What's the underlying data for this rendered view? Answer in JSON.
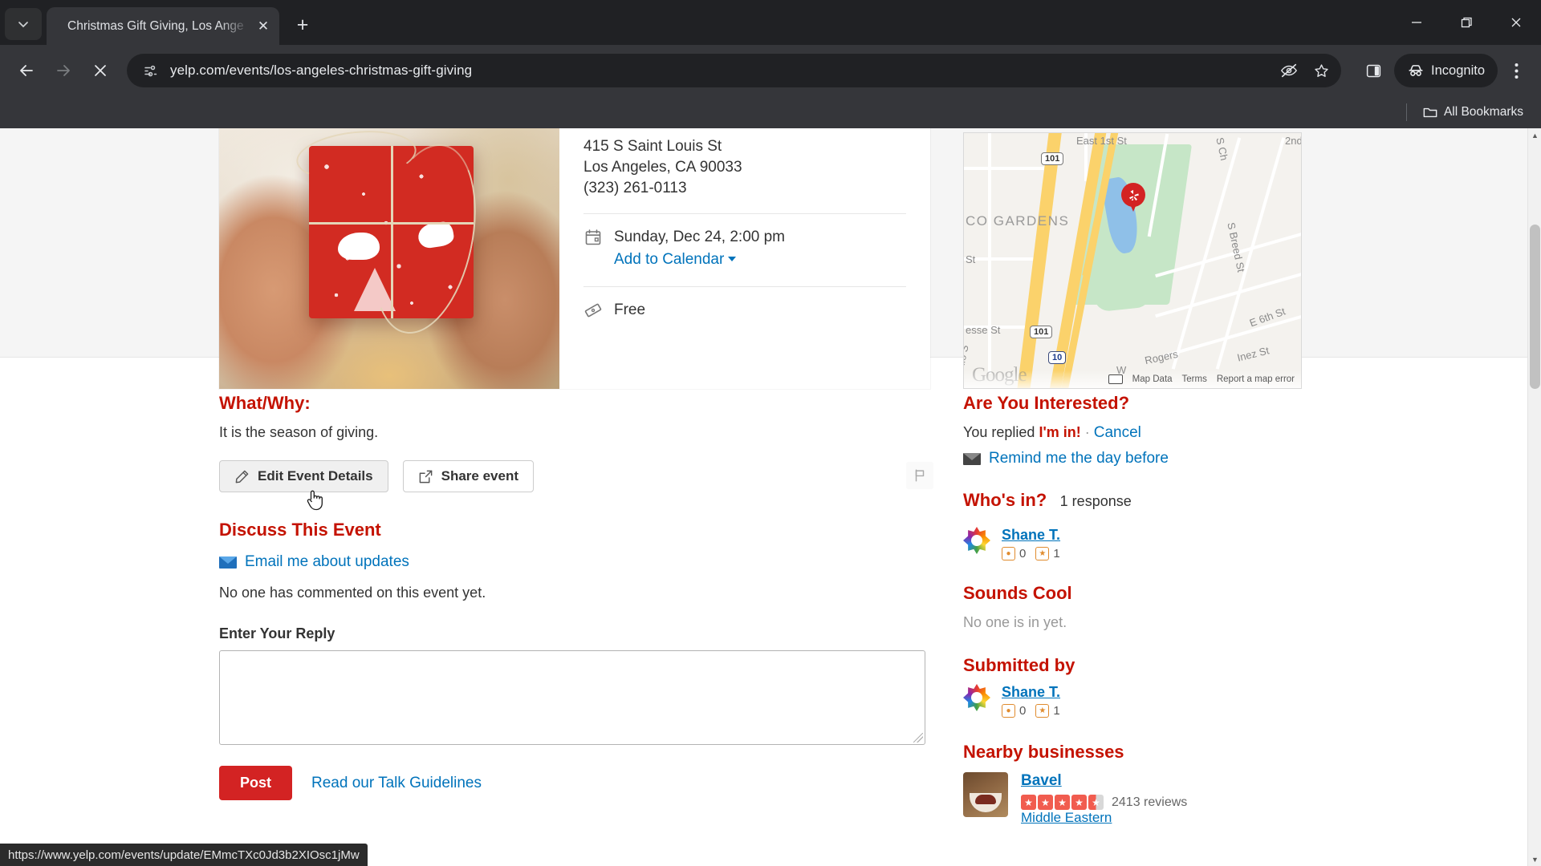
{
  "browser": {
    "tab": {
      "title": "Christmas Gift Giving, Los Ange",
      "close_label": "✕"
    },
    "new_tab_label": "+",
    "tab_search_icon": "chevron-down-icon",
    "window": {
      "minimize": "—",
      "maximize": "❐",
      "close": "✕"
    },
    "nav": {
      "back": "←",
      "forward": "→",
      "stop": "✕"
    },
    "omnibox": {
      "url": "yelp.com/events/los-angeles-christmas-gift-giving",
      "site_info_icon": "page-info-icon",
      "tracking_icon": "eye-slash-icon",
      "bookmark_icon": "star-icon"
    },
    "side_panel_icon": "side-panel-icon",
    "profile": {
      "label": "Incognito",
      "icon": "incognito-icon"
    },
    "menu_icon": "three-dot-menu-icon",
    "bookmarks": {
      "all_label": "All Bookmarks",
      "folder_icon": "folder-icon"
    },
    "status_bar_url": "https://www.yelp.com/events/update/EMmcTXc0Jd3b2XIOsc1jMw"
  },
  "event": {
    "photo_alt": "hands holding red wrapped christmas gift",
    "address": {
      "street": "415 S Saint Louis St",
      "city_state_zip": "Los Angeles, CA 90033",
      "phone": "(323) 261-0113"
    },
    "datetime": {
      "icon": "calendar-icon",
      "text": "Sunday, Dec 24, 2:00 pm",
      "add_to_calendar": "Add to Calendar"
    },
    "price": {
      "icon": "ticket-icon",
      "text": "Free"
    }
  },
  "map": {
    "labels": [
      "East 1st St",
      "CO GARDENS",
      "St",
      "esse St",
      "Rio S",
      "S Breed St",
      "S Ch",
      "2nd",
      "E 6th St",
      "Inez St",
      "Rogers",
      "W"
    ],
    "shields": [
      "101",
      "101",
      "10"
    ],
    "attribution": {
      "map_data": "Map Data",
      "terms": "Terms",
      "report": "Report a map error",
      "watermark": "Google",
      "keyboard_icon": "keyboard-shortcuts-icon"
    },
    "pin_icon": "yelp-pin-icon"
  },
  "left": {
    "whatwhy_heading": "What/Why:",
    "whatwhy_body": "It is the season of giving.",
    "edit_button": {
      "label": "Edit Event Details",
      "icon": "pencil-icon"
    },
    "share_button": {
      "label": "Share event",
      "icon": "share-arrow-icon"
    },
    "flag_icon": "flag-icon",
    "discuss_heading": "Discuss This Event",
    "email_updates_link": "Email me about updates",
    "email_icon": "envelope-icon",
    "no_comments": "No one has commented on this event yet.",
    "reply_label": "Enter Your Reply",
    "reply_value": "",
    "reply_placeholder": "",
    "post_label": "Post",
    "guidelines_link": "Read our Talk Guidelines"
  },
  "right": {
    "interested_heading": "Are You Interested?",
    "replied_prefix": "You replied",
    "replied_value": "I'm in!",
    "replied_sep": "·",
    "cancel_link": "Cancel",
    "remind_link": "Remind me the day before",
    "remind_icon": "envelope-icon",
    "whos_in_heading": "Who's in?",
    "whos_in_count": "1 response",
    "attendee": {
      "name": "Shane T.",
      "avatar_icon": "yelp-burst-avatar",
      "photos_icon": "photo-badge-icon",
      "photos_count": "0",
      "reviews_icon": "review-star-badge-icon",
      "reviews_count": "1"
    },
    "sounds_cool_heading": "Sounds Cool",
    "sounds_cool_empty": "No one is in yet.",
    "submitted_heading": "Submitted by",
    "submitter": {
      "name": "Shane T.",
      "avatar_icon": "yelp-burst-avatar",
      "photos_icon": "photo-badge-icon",
      "photos_count": "0",
      "reviews_icon": "review-star-badge-icon",
      "reviews_count": "1"
    },
    "nearby_heading": "Nearby businesses",
    "business": {
      "name": "Bavel",
      "rating": 4.5,
      "reviews": "2413 reviews",
      "category": "Middle Eastern"
    }
  },
  "colors": {
    "yelp_red": "#d32323",
    "heading_red": "#c41200",
    "link_blue": "#0073bb",
    "chrome_dark": "#35363a",
    "tabstrip_dark": "#202124"
  }
}
